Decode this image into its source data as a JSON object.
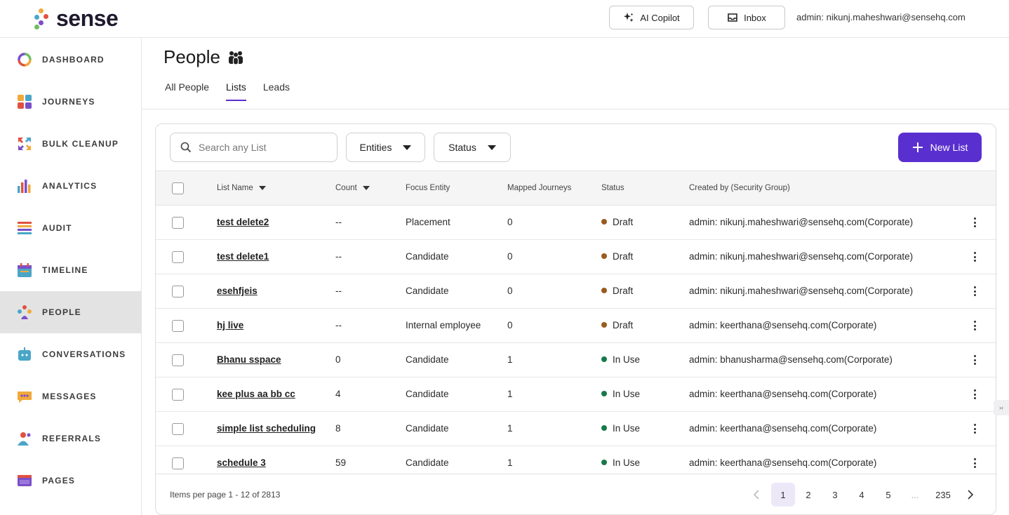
{
  "brand": {
    "name": "sense"
  },
  "header": {
    "copilot_label": "AI Copilot",
    "inbox_label": "Inbox",
    "user": "admin: nikunj.maheshwari@sensehq.com"
  },
  "sidebar": {
    "items": [
      {
        "label": "DASHBOARD",
        "icon": "dashboard-ring-icon"
      },
      {
        "label": "JOURNEYS",
        "icon": "journeys-grid-icon"
      },
      {
        "label": "BULK CLEANUP",
        "icon": "bulk-cleanup-icon"
      },
      {
        "label": "ANALYTICS",
        "icon": "analytics-bars-icon"
      },
      {
        "label": "AUDIT",
        "icon": "audit-list-icon"
      },
      {
        "label": "TIMELINE",
        "icon": "timeline-calendar-icon"
      },
      {
        "label": "PEOPLE",
        "icon": "people-group-icon",
        "active": true
      },
      {
        "label": "CONVERSATIONS",
        "icon": "conversations-bot-icon"
      },
      {
        "label": "MESSAGES",
        "icon": "messages-bubble-icon"
      },
      {
        "label": "REFERRALS",
        "icon": "referrals-person-icon"
      },
      {
        "label": "PAGES",
        "icon": "pages-window-icon"
      }
    ]
  },
  "page": {
    "title": "People",
    "tabs": [
      {
        "label": "All People"
      },
      {
        "label": "Lists",
        "active": true
      },
      {
        "label": "Leads"
      }
    ]
  },
  "toolbar": {
    "search_placeholder": "Search any List",
    "entities_label": "Entities",
    "status_label": "Status",
    "new_list_label": "New List"
  },
  "table": {
    "columns": {
      "list_name": "List Name",
      "count": "Count",
      "focus_entity": "Focus Entity",
      "mapped_journeys": "Mapped Journeys",
      "status": "Status",
      "created_by": "Created by (Security Group)"
    },
    "rows": [
      {
        "name": "test delete2",
        "count": "--",
        "entity": "Placement",
        "journeys": "0",
        "status": "Draft",
        "created_by": "admin: nikunj.maheshwari@sensehq.com(Corporate)"
      },
      {
        "name": "test delete1",
        "count": "--",
        "entity": "Candidate",
        "journeys": "0",
        "status": "Draft",
        "created_by": "admin: nikunj.maheshwari@sensehq.com(Corporate)"
      },
      {
        "name": "esehfjeis",
        "count": "--",
        "entity": "Candidate",
        "journeys": "0",
        "status": "Draft",
        "created_by": "admin: nikunj.maheshwari@sensehq.com(Corporate)"
      },
      {
        "name": "hj live",
        "count": "--",
        "entity": "Internal employee",
        "journeys": "0",
        "status": "Draft",
        "created_by": "admin: keerthana@sensehq.com(Corporate)"
      },
      {
        "name": "Bhanu sspace",
        "count": "0",
        "entity": "Candidate",
        "journeys": "1",
        "status": "In Use",
        "created_by": "admin: bhanusharma@sensehq.com(Corporate)"
      },
      {
        "name": "kee plus aa bb cc",
        "count": "4",
        "entity": "Candidate",
        "journeys": "1",
        "status": "In Use",
        "created_by": "admin: keerthana@sensehq.com(Corporate)"
      },
      {
        "name": "simple list scheduling",
        "count": "8",
        "entity": "Candidate",
        "journeys": "1",
        "status": "In Use",
        "created_by": "admin: keerthana@sensehq.com(Corporate)"
      },
      {
        "name": "schedule 3",
        "count": "59",
        "entity": "Candidate",
        "journeys": "1",
        "status": "In Use",
        "created_by": "admin: keerthana@sensehq.com(Corporate)"
      }
    ]
  },
  "status_colors": {
    "Draft": "#9a5b1e",
    "In Use": "#17794a"
  },
  "pagination": {
    "info": "Items per page 1 - 12 of 2813",
    "pages": [
      "1",
      "2",
      "3",
      "4",
      "5",
      "...",
      "235"
    ],
    "current": "1"
  },
  "colors": {
    "accent": "#5a2fcf"
  }
}
